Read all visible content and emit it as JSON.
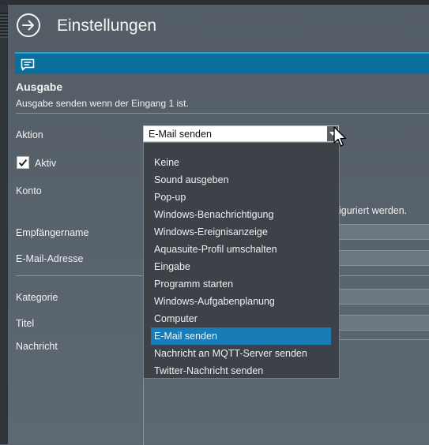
{
  "header": {
    "title": "Einstellungen"
  },
  "section": {
    "title": "Ausgabe",
    "description": "Ausgabe senden wenn der Eingang 1 ist."
  },
  "form": {
    "aktion_label": "Aktion",
    "aktion_value": "E-Mail senden",
    "aktiv_label": "Aktiv",
    "konto_label": "Konto",
    "konto_hint_partial": "iguriert werden.",
    "empfaengername_label": "Empfängername",
    "email_label": "E-Mail-Adresse",
    "kategorie_label": "Kategorie",
    "titel_label": "Titel",
    "nachricht_label": "Nachricht"
  },
  "dropdown": {
    "options": [
      "Keine",
      "Sound ausgeben",
      "Pop-up",
      "Windows-Benachrichtigung",
      "Windows-Ereignisanzeige",
      "Aquasuite-Profil umschalten",
      "Eingabe",
      "Programm starten",
      "Windows-Aufgabenplanung",
      "Computer",
      "E-Mail senden",
      "Nachricht an MQTT-Server senden",
      "Twitter-Nachricht senden"
    ],
    "selected": "E-Mail senden"
  },
  "colors": {
    "accent": "#0a6f9b",
    "selection": "#1a7cb6",
    "panel": "#5b656e"
  },
  "icons": {
    "back": "arrow-right-circle-icon",
    "banner": "message-icon",
    "checkbox": "check-icon",
    "select": "chevron-down-icon"
  }
}
